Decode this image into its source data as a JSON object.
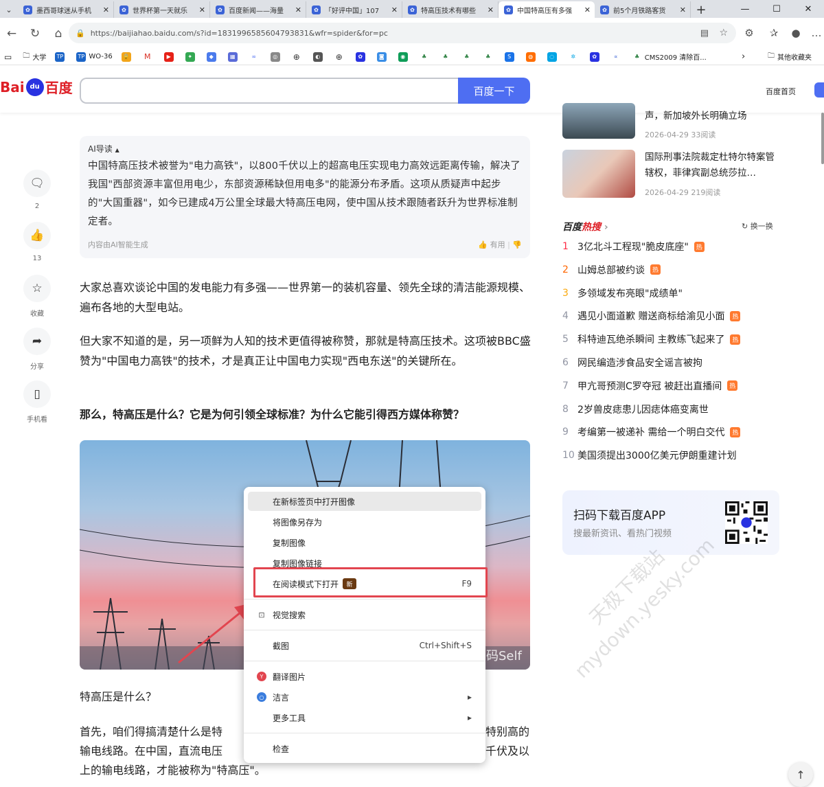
{
  "browser": {
    "tabs": [
      {
        "label": "墨西哥球迷从手机"
      },
      {
        "label": "世界杯第一天就乐"
      },
      {
        "label": "百度新闻——海量"
      },
      {
        "label": "「好评中国」107"
      },
      {
        "label": "特高压技术有哪些"
      },
      {
        "label": "中国特高压有多强"
      },
      {
        "label": "前5个月铁路客货"
      }
    ],
    "active_tab": 5,
    "url": "https://baijiahao.baidu.com/s?id=1831996585604793831&wfr=spider&for=pc",
    "bookmarks": [
      {
        "label": "大学",
        "icon": "folder-icon"
      },
      {
        "label": "",
        "icon": "tp-icon"
      },
      {
        "label": "WO-36",
        "icon": "tp-icon"
      },
      {
        "label": "CMS2009 清除百...",
        "icon": "browser-icon"
      }
    ],
    "other_bookmarks": "其他收藏夹"
  },
  "baidu": {
    "logo_left": "Bai",
    "logo_paw": "du",
    "logo_right": "百度",
    "search_button": "百度一下",
    "home_link": "百度首页"
  },
  "actions": [
    {
      "label": "2",
      "icon": "comment-icon"
    },
    {
      "label": "13",
      "icon": "thumbs-up-icon"
    },
    {
      "label": "收藏",
      "icon": "star-icon"
    },
    {
      "label": "分享",
      "icon": "share-icon"
    },
    {
      "label": "手机看",
      "icon": "phone-icon"
    }
  ],
  "ai_card": {
    "title": "AI导读",
    "body": "中国特高压技术被誉为\"电力高铁\"，以800千伏以上的超高电压实现电力高效远距离传输，解决了我国\"西部资源丰富但用电少，东部资源稀缺但用电多\"的能源分布矛盾。这项从质疑声中起步的\"大国重器\"，如今已建成4万公里全球最大特高压电网，使中国从技术跟随者跃升为世界标准制定者。",
    "footer": "内容由AI智能生成",
    "useful": "有用"
  },
  "article": {
    "p1": "大家总喜欢谈论中国的发电能力有多强——世界第一的装机容量、领先全球的清洁能源规模、遍布各地的大型电站。",
    "p2": "但大家不知道的是，另一项鲜为人知的技术更值得被称赞，那就是特高压技术。这项被BBC盛赞为\"中国电力高铁\"的技术，才是真正让中国电力实现\"西电东送\"的关键所在。",
    "p3": "那么，特高压是什么？它是为何引领全球标准？为什么它能引得西方媒体称赞？",
    "image_watermark": "码Self",
    "h2": "特高压是什么？",
    "p4a": "首先，咱们得搞清楚什么是特",
    "p4b": "特别高的",
    "p5a": "输电线路。在中国，直流电压",
    "p5b": "千伏及以",
    "p6": "上的输电线路，才能被称为\"特高压\"。"
  },
  "context_menu": {
    "items": [
      {
        "label": "在新标签页中打开图像"
      },
      {
        "label": "将图像另存为"
      },
      {
        "label": "复制图像"
      },
      {
        "label": "复制图像链接"
      },
      {
        "label": "在阅读模式下打开",
        "badge": "新",
        "shortcut": "F9"
      },
      {
        "label": "视觉搜索",
        "icon": "visual-search-icon"
      },
      {
        "label": "截图",
        "shortcut": "Ctrl+Shift+S"
      },
      {
        "label": "翻译图片",
        "icon": "translate-icon"
      },
      {
        "label": "洁言",
        "icon": "circle-icon"
      },
      {
        "label": "更多工具"
      },
      {
        "label": "检查"
      }
    ]
  },
  "sidebar": {
    "news": [
      {
        "title": "声，新加坡外长明确立场",
        "meta": "2026-04-29  33阅读"
      },
      {
        "title": "国际刑事法院裁定杜特尔特案管辖权，菲律宾副总统莎拉…",
        "meta": "2026-04-29  219阅读"
      }
    ],
    "hot_title_a": "百度",
    "hot_title_b": "热搜",
    "refresh": "换一换",
    "hot": [
      {
        "rank": "1",
        "text": "3亿北斗工程现\"脆皮底座\"",
        "hot": true
      },
      {
        "rank": "2",
        "text": "山姆总部被约谈",
        "hot": true
      },
      {
        "rank": "3",
        "text": "多领域发布亮眼\"成绩单\"",
        "hot": false
      },
      {
        "rank": "4",
        "text": "遇见小面道歉 赠送商标给渝见小面",
        "hot": true
      },
      {
        "rank": "5",
        "text": "科特迪瓦绝杀瞬间 主教练飞起来了",
        "hot": true
      },
      {
        "rank": "6",
        "text": "网民编造涉食品安全谣言被拘",
        "hot": false
      },
      {
        "rank": "7",
        "text": "甲亢哥预测C罗夺冠 被赶出直播间",
        "hot": true
      },
      {
        "rank": "8",
        "text": "2岁兽皮痣患儿因痣体癌变离世",
        "hot": false
      },
      {
        "rank": "9",
        "text": "考编第一被递补 需给一个明白交代",
        "hot": true
      },
      {
        "rank": "10",
        "text": "美国须提出3000亿美元伊朗重建计划",
        "hot": false
      }
    ],
    "hot_badge": "热",
    "app_title": "扫码下载百度APP",
    "app_sub": "搜最新资讯、看热门视频"
  },
  "watermark": {
    "line1": "天极下载站",
    "line2": "mydown.yesky.com"
  },
  "colors": {
    "accent": "#4e6ef2",
    "red": "#de1f26",
    "highlight": "#e2454f"
  }
}
